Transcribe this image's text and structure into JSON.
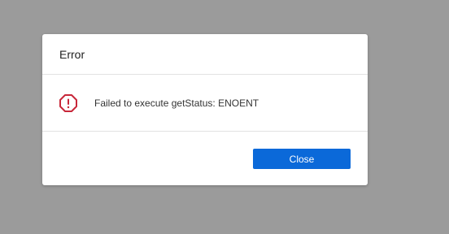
{
  "dialog": {
    "title": "Error",
    "message": "Failed to execute getStatus: ENOENT",
    "icon": "error-octagon-icon",
    "close_label": "Close"
  },
  "colors": {
    "overlay": "#9b9b9b",
    "error_icon": "#c8283a",
    "primary_button": "#0b69d9"
  }
}
